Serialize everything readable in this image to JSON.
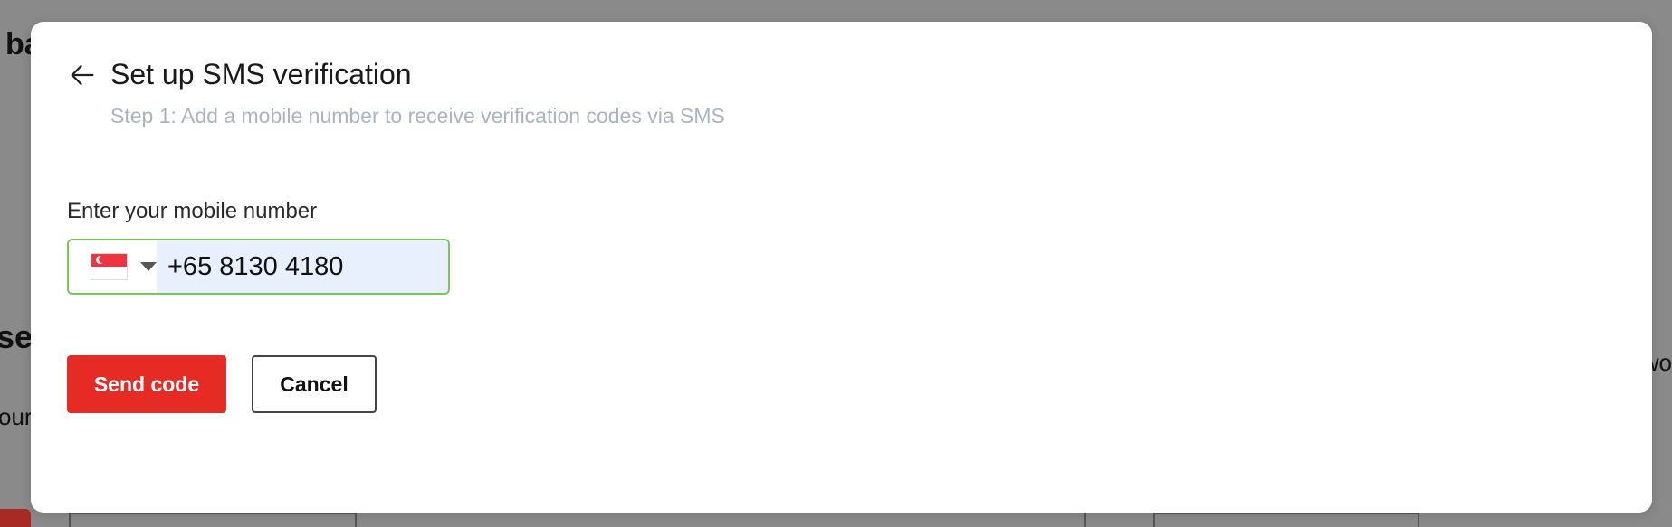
{
  "background": {
    "fragment_top": "ba",
    "fragment_mid": "ser",
    "fragment_low": "our",
    "fragment_right": "wo"
  },
  "modal": {
    "title": "Set up SMS verification",
    "subtitle": "Step 1: Add a mobile number to receive verification codes via SMS",
    "field_label": "Enter your mobile number",
    "country": {
      "flag_icon": "singapore-flag-icon",
      "caret_icon": "caret-down-icon"
    },
    "phone_value": "+65 8130 4180",
    "buttons": {
      "send_code": "Send code",
      "cancel": "Cancel"
    },
    "colors": {
      "primary": "#e62b25",
      "focus_border": "#7ac55a",
      "input_fill": "#e8f0fe",
      "subtitle": "#a9b4bf"
    }
  }
}
